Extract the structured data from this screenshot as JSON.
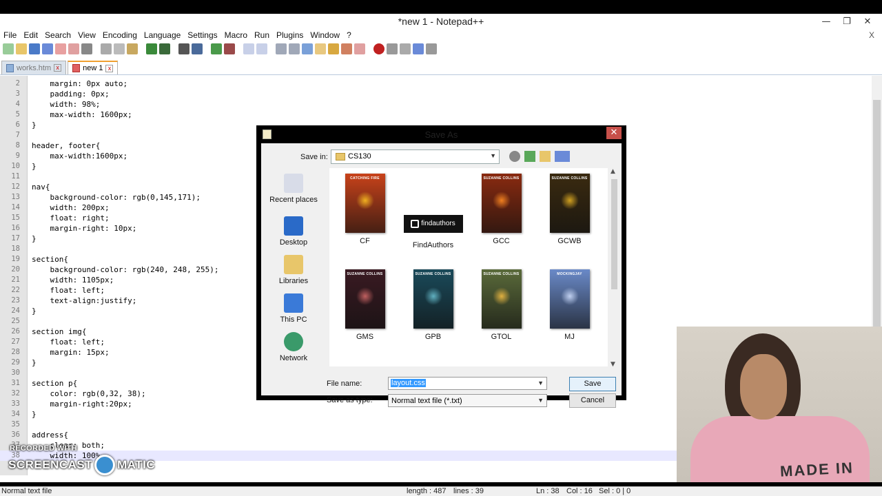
{
  "app": {
    "title": "*new 1 - Notepad++",
    "menu": [
      "File",
      "Edit",
      "Search",
      "View",
      "Encoding",
      "Language",
      "Settings",
      "Macro",
      "Run",
      "Plugins",
      "Window",
      "?"
    ],
    "menu_close": "X",
    "tabs": [
      {
        "label": "works.htm",
        "active": false
      },
      {
        "label": "new 1",
        "active": true
      }
    ]
  },
  "editor": {
    "lines": [
      {
        "n": "2",
        "code": "    margin: 0px auto;"
      },
      {
        "n": "3",
        "code": "    padding: 0px;"
      },
      {
        "n": "4",
        "code": "    width: 98%;"
      },
      {
        "n": "5",
        "code": "    max-width: 1600px;"
      },
      {
        "n": "6",
        "code": "}"
      },
      {
        "n": "7",
        "code": ""
      },
      {
        "n": "8",
        "code": "header, footer{"
      },
      {
        "n": "9",
        "code": "    max-width:1600px;"
      },
      {
        "n": "10",
        "code": "}"
      },
      {
        "n": "11",
        "code": ""
      },
      {
        "n": "12",
        "code": "nav{"
      },
      {
        "n": "13",
        "code": "    background-color: rgb(0,145,171);"
      },
      {
        "n": "14",
        "code": "    width: 200px;"
      },
      {
        "n": "15",
        "code": "    float: right;"
      },
      {
        "n": "16",
        "code": "    margin-right: 10px;"
      },
      {
        "n": "17",
        "code": "}"
      },
      {
        "n": "18",
        "code": ""
      },
      {
        "n": "19",
        "code": "section{"
      },
      {
        "n": "20",
        "code": "    background-color: rgb(240, 248, 255);"
      },
      {
        "n": "21",
        "code": "    width: 1105px;"
      },
      {
        "n": "22",
        "code": "    float: left;"
      },
      {
        "n": "23",
        "code": "    text-align:justify;"
      },
      {
        "n": "24",
        "code": "}"
      },
      {
        "n": "25",
        "code": ""
      },
      {
        "n": "26",
        "code": "section img{"
      },
      {
        "n": "27",
        "code": "    float: left;"
      },
      {
        "n": "28",
        "code": "    margin: 15px;"
      },
      {
        "n": "29",
        "code": "}"
      },
      {
        "n": "30",
        "code": ""
      },
      {
        "n": "31",
        "code": "section p{"
      },
      {
        "n": "32",
        "code": "    color: rgb(0,32, 38);"
      },
      {
        "n": "33",
        "code": "    margin-right:20px;"
      },
      {
        "n": "34",
        "code": "}"
      },
      {
        "n": "35",
        "code": ""
      },
      {
        "n": "36",
        "code": "address{"
      },
      {
        "n": "37",
        "code": "    clear: both;"
      },
      {
        "n": "38",
        "code": "    width: 100%"
      }
    ]
  },
  "statusbar": {
    "type": "Normal text file",
    "length": "length : 487",
    "lines": "lines : 39",
    "ln": "Ln : 38",
    "col": "Col : 16",
    "sel": "Sel : 0 | 0"
  },
  "watermark": {
    "top": "RECORDED WITH",
    "left": "SCREENCAST",
    "right": "MATIC"
  },
  "dialog": {
    "title": "Save As",
    "save_in_label": "Save in:",
    "save_in_value": "CS130",
    "places": [
      "Recent places",
      "Desktop",
      "Libraries",
      "This PC",
      "Network"
    ],
    "files": [
      {
        "name": "CF",
        "cover_title": "CATCHING FIRE",
        "bg": "#c8421a",
        "accent": "#f0b020"
      },
      {
        "name": "FindAuthors",
        "cover_title": "findauthors",
        "bg": "#111111",
        "accent": "#ffffff"
      },
      {
        "name": "GCC",
        "cover_title": "SUZANNE COLLINS",
        "bg": "#8a2a10",
        "accent": "#f08020"
      },
      {
        "name": "GCWB",
        "cover_title": "SUZANNE COLLINS",
        "bg": "#3a2a10",
        "accent": "#d0a020"
      },
      {
        "name": "GMS",
        "cover_title": "SUZANNE COLLINS",
        "bg": "#3a1a22",
        "accent": "#c06060"
      },
      {
        "name": "GPB",
        "cover_title": "SUZANNE COLLINS",
        "bg": "#1a4a5a",
        "accent": "#60b0c0"
      },
      {
        "name": "GTOL",
        "cover_title": "SUZANNE COLLINS",
        "bg": "#5a6a3a",
        "accent": "#e0b040"
      },
      {
        "name": "MJ",
        "cover_title": "MOCKINGJAY",
        "bg": "#6a8ac8",
        "accent": "#c0d0f0"
      }
    ],
    "file_name_label": "File name:",
    "file_name_value": "layout.css",
    "save_type_label": "Save as type:",
    "save_type_value": "Normal text file (*.txt)",
    "save_button": "Save",
    "cancel_button": "Cancel"
  },
  "webcam": {
    "shirt_text": "MADE IN"
  }
}
